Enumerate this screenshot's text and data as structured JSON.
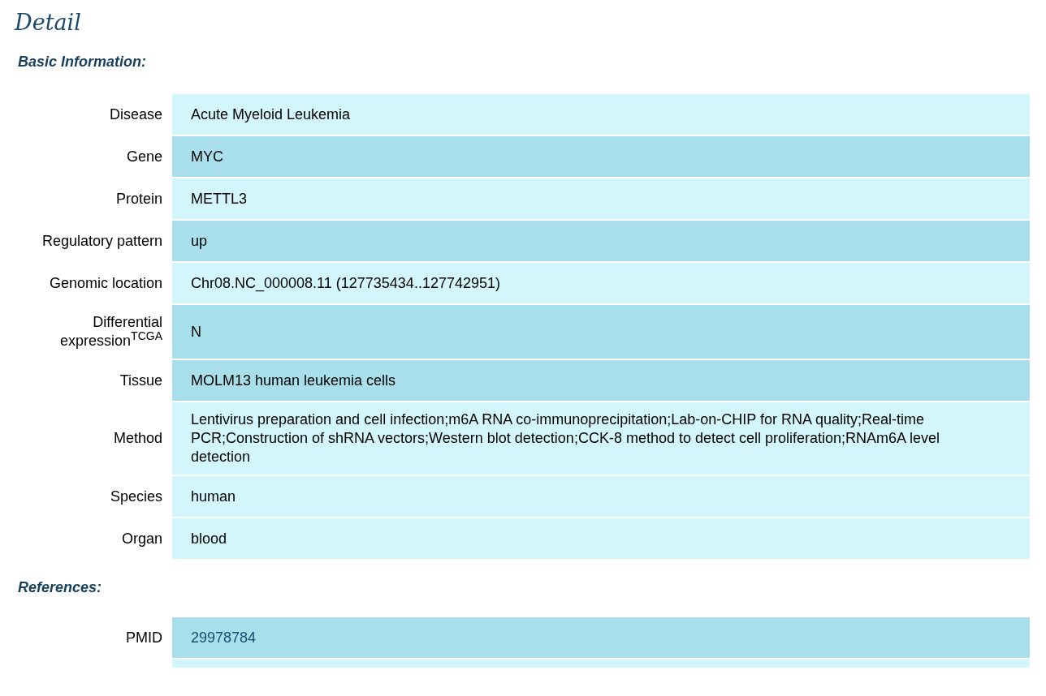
{
  "title": "Detail",
  "basic_information": {
    "heading": "Basic Information:",
    "rows": [
      {
        "label": "Disease",
        "value": "Acute Myeloid Leukemia",
        "kind": "light"
      },
      {
        "label": "Gene",
        "value": "MYC",
        "kind": "dark"
      },
      {
        "label": "Protein",
        "value": "METTL3",
        "kind": "light"
      },
      {
        "label": "Regulatory pattern",
        "value": "up",
        "kind": "dark"
      },
      {
        "label": "Genomic location",
        "value": "Chr08.NC_000008.11 (127735434..127742951)",
        "kind": "light"
      },
      {
        "label": "Differential expression$^{TCGA}$",
        "value": "N",
        "kind": "dark"
      },
      {
        "label": "Tissue",
        "value": "MOLM13 human leukemia cells",
        "kind": "dark"
      },
      {
        "label": "Method",
        "value": "Lentivirus preparation and cell infection;m6A RNA co-immunoprecipitation;Lab-on-CHIP for RNA quality;Real-time PCR;Construction of shRNA vectors;Western blot detection;CCK-8 method to detect cell proliferation;RNAm6A level detection",
        "kind": "light"
      },
      {
        "label": "Species",
        "value": "human",
        "kind": "light"
      },
      {
        "label": "Organ",
        "value": "blood",
        "kind": "light"
      }
    ]
  },
  "references": {
    "heading": "References:",
    "rows": [
      {
        "label": "PMID",
        "value": "29978784",
        "kind": "dark",
        "link": true
      },
      {
        "kind": "light"
      }
    ]
  }
}
